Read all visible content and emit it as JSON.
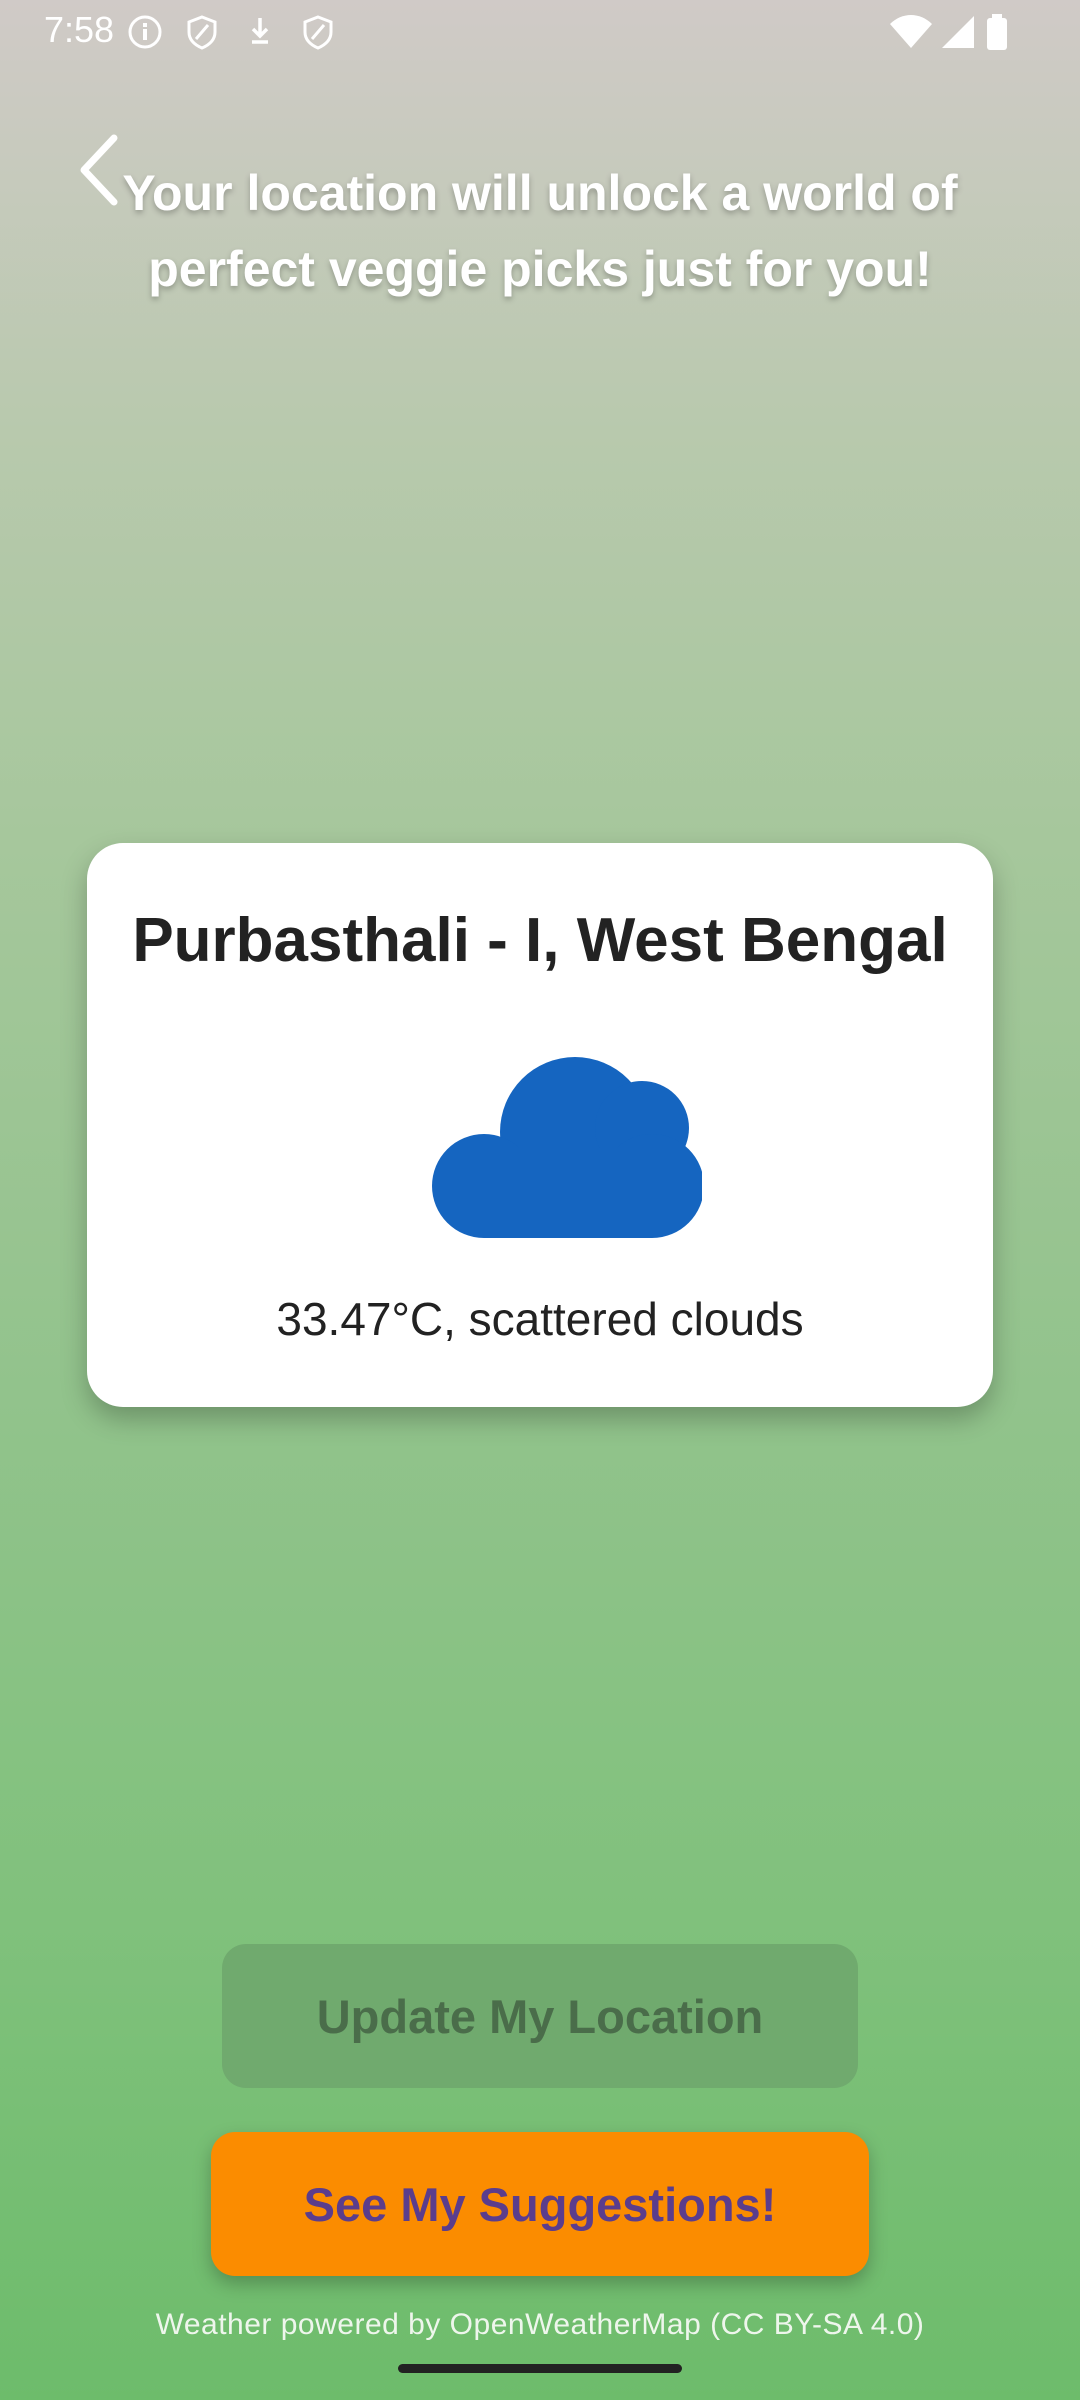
{
  "status_bar": {
    "time": "7:58",
    "left_icons": [
      "info-icon",
      "shield-icon",
      "download-icon",
      "shield-icon"
    ],
    "right_icons": [
      "wifi-icon",
      "signal-icon",
      "battery-icon"
    ]
  },
  "header": {
    "back_icon": "chevron-left-icon",
    "headline": "Your location will unlock a world of perfect veggie picks just for you!"
  },
  "weather_card": {
    "location": "Purbasthali - I, West Bengal",
    "icon": "cloud-icon",
    "icon_color": "#1565c0",
    "description": "33.47°C, scattered clouds"
  },
  "actions": {
    "update_label": "Update My Location",
    "suggest_label": "See My Suggestions!"
  },
  "footer": {
    "attribution": "Weather powered by OpenWeatherMap (CC BY-SA 4.0)"
  },
  "colors": {
    "accent": "#fb8c00",
    "suggest_text": "#5b3d8c",
    "update_button": "#70aa6e",
    "card_background": "#ffffff"
  }
}
